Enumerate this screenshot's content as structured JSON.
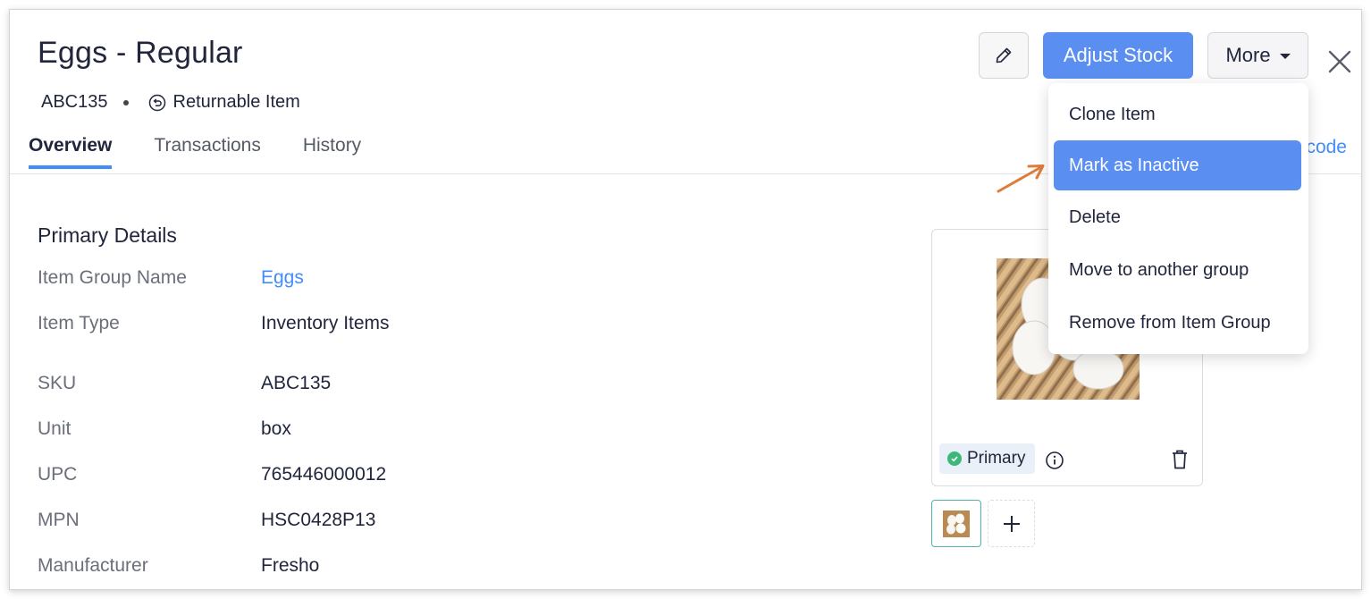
{
  "header": {
    "title": "Eggs - Regular",
    "sku_badge": "ABC135",
    "returnable_label": "Returnable Item"
  },
  "tabs": [
    {
      "label": "Overview",
      "active": true
    },
    {
      "label": "Transactions",
      "active": false
    },
    {
      "label": "History",
      "active": false
    }
  ],
  "barcode_link_fragment": "code",
  "toolbar": {
    "edit_icon": "pencil-icon",
    "adjust_stock_label": "Adjust Stock",
    "more_label": "More",
    "close_icon": "close-icon"
  },
  "more_menu": {
    "items": [
      {
        "label": "Clone Item",
        "active": false
      },
      {
        "label": "Mark as Inactive",
        "active": true
      },
      {
        "label": "Delete",
        "active": false
      },
      {
        "label": "Move to another group",
        "active": false
      },
      {
        "label": "Remove from Item Group",
        "active": false
      }
    ]
  },
  "primary_details": {
    "title": "Primary Details",
    "rows": [
      {
        "label": "Item Group Name",
        "value": "Eggs",
        "is_link": true
      },
      {
        "label": "Item Type",
        "value": "Inventory Items"
      },
      {
        "label": "SKU",
        "value": "ABC135"
      },
      {
        "label": "Unit",
        "value": "box"
      },
      {
        "label": "UPC",
        "value": "765446000012"
      },
      {
        "label": "MPN",
        "value": "HSC0428P13"
      },
      {
        "label": "Manufacturer",
        "value": "Fresho"
      }
    ]
  },
  "image_panel": {
    "primary_badge": "Primary"
  },
  "colors": {
    "accent": "#408dfb",
    "button_primary": "#5a8ef1",
    "annotation_arrow": "#e07b39",
    "success": "#3cb878"
  }
}
